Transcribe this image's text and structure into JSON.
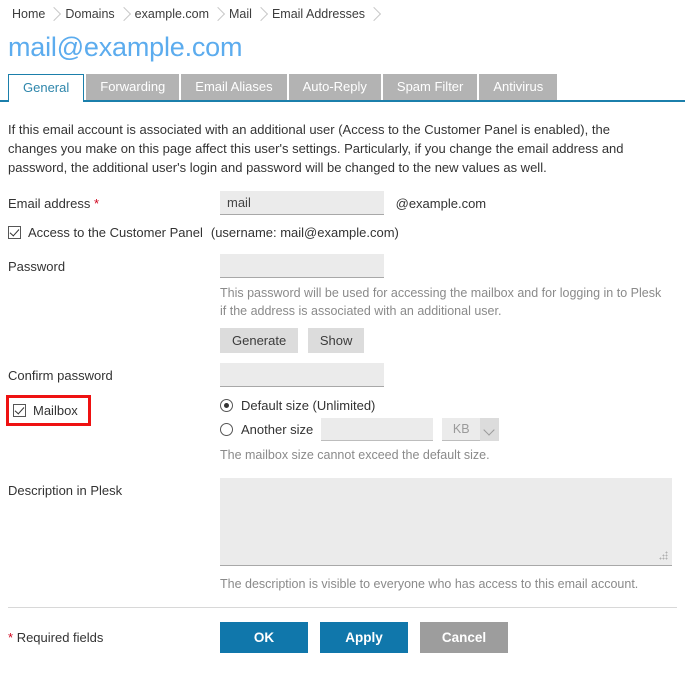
{
  "breadcrumb": {
    "items": [
      {
        "label": "Home"
      },
      {
        "label": "Domains"
      },
      {
        "label": "example.com"
      },
      {
        "label": "Mail"
      },
      {
        "label": "Email Addresses"
      }
    ]
  },
  "page_title": "mail@example.com",
  "tabs": [
    {
      "label": "General",
      "active": true
    },
    {
      "label": "Forwarding",
      "active": false
    },
    {
      "label": "Email Aliases",
      "active": false
    },
    {
      "label": "Auto-Reply",
      "active": false
    },
    {
      "label": "Spam Filter",
      "active": false
    },
    {
      "label": "Antivirus",
      "active": false
    }
  ],
  "intro": "If this email account is associated with an additional user (Access to the Customer Panel is enabled), the changes you make on this page affect this user's settings. Particularly, if you change the email address and password, the additional user's login and password will be changed to the new values as well.",
  "form": {
    "email": {
      "label": "Email address",
      "required_marker": "*",
      "value": "mail",
      "domain_suffix": "@example.com"
    },
    "customer_panel": {
      "label": "Access to the Customer Panel",
      "username_note": "(username: mail@example.com)",
      "checked": true
    },
    "password": {
      "label": "Password",
      "value": "",
      "hint": "This password will be used for accessing the mailbox and for logging in to Plesk if the address is associated with an additional user.",
      "generate_label": "Generate",
      "show_label": "Show"
    },
    "confirm_password": {
      "label": "Confirm password",
      "value": ""
    },
    "mailbox": {
      "label": "Mailbox",
      "checked": true,
      "highlighted": true,
      "options": [
        {
          "label": "Default size (Unlimited)",
          "selected": true
        },
        {
          "label": "Another size",
          "selected": false
        }
      ],
      "size_value": "",
      "unit_value": "KB",
      "hint": "The mailbox size cannot exceed the default size."
    },
    "description": {
      "label": "Description in Plesk",
      "value": "",
      "hint": "The description is visible to everyone who has access to this email account."
    }
  },
  "footer": {
    "required_fields": "* Required fields",
    "ok_label": "OK",
    "apply_label": "Apply",
    "cancel_label": "Cancel"
  },
  "colors": {
    "accent_blue": "#1077ab",
    "title_blue": "#5cacee",
    "tab_inactive": "#b3b3b3",
    "highlight_red": "#ee1111",
    "required_red": "#d0021b",
    "field_bg": "#ebebeb",
    "cancel_gray": "#9d9d9d"
  }
}
